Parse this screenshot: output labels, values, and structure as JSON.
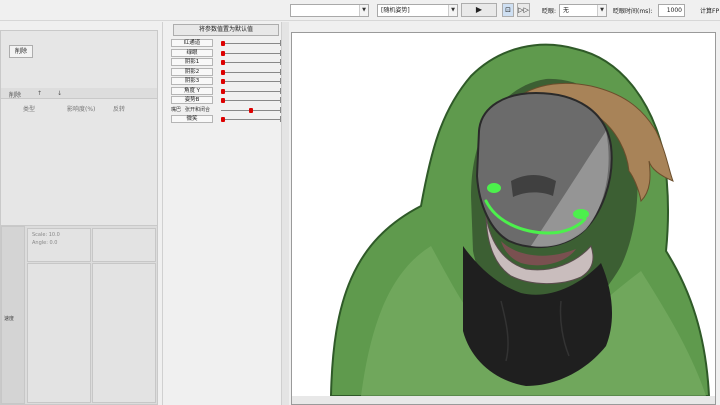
{
  "topbar": {
    "select1_value": "",
    "select2_value": "[随机姿势]",
    "blink_label": "眨眼:",
    "blink_value": "无",
    "blink_time_label": "眨眼时间(ms):",
    "blink_time_value": "1000",
    "calc_label": "计算FP"
  },
  "left_panel": {
    "delete_button": "削除",
    "toolbar": [
      "削除",
      "↑",
      "↓"
    ],
    "columns": [
      "类型",
      "影响度(%)",
      "反转"
    ],
    "scale_text": "Scale: 10.0",
    "angle_text": "Angle: 0.0",
    "side_label": "速度"
  },
  "params_panel": {
    "title": "将参数值置为默认值",
    "params": [
      {
        "label": "红通道",
        "value": 0.0
      },
      {
        "label": "绿眼",
        "value": 0.0
      },
      {
        "label": "阴影1",
        "value": 0.0
      },
      {
        "label": "阴影2",
        "value": 0.0
      },
      {
        "label": "阴影3",
        "value": 0.0
      },
      {
        "label": "角度 Y",
        "value": 0.0
      },
      {
        "label": "姿势B",
        "value": 0.0
      }
    ],
    "direction_label": "嘴巴",
    "direction_value": "张开和闭合",
    "direction_value_num": 0.5,
    "last_param": {
      "label": "微笑",
      "value": 0.0
    }
  },
  "colors": {
    "hood_green": "#5f9a4d",
    "mask_gray": "#6b6b6b",
    "eye_green": "#4cf04c",
    "hair_brown": "#a88358"
  }
}
